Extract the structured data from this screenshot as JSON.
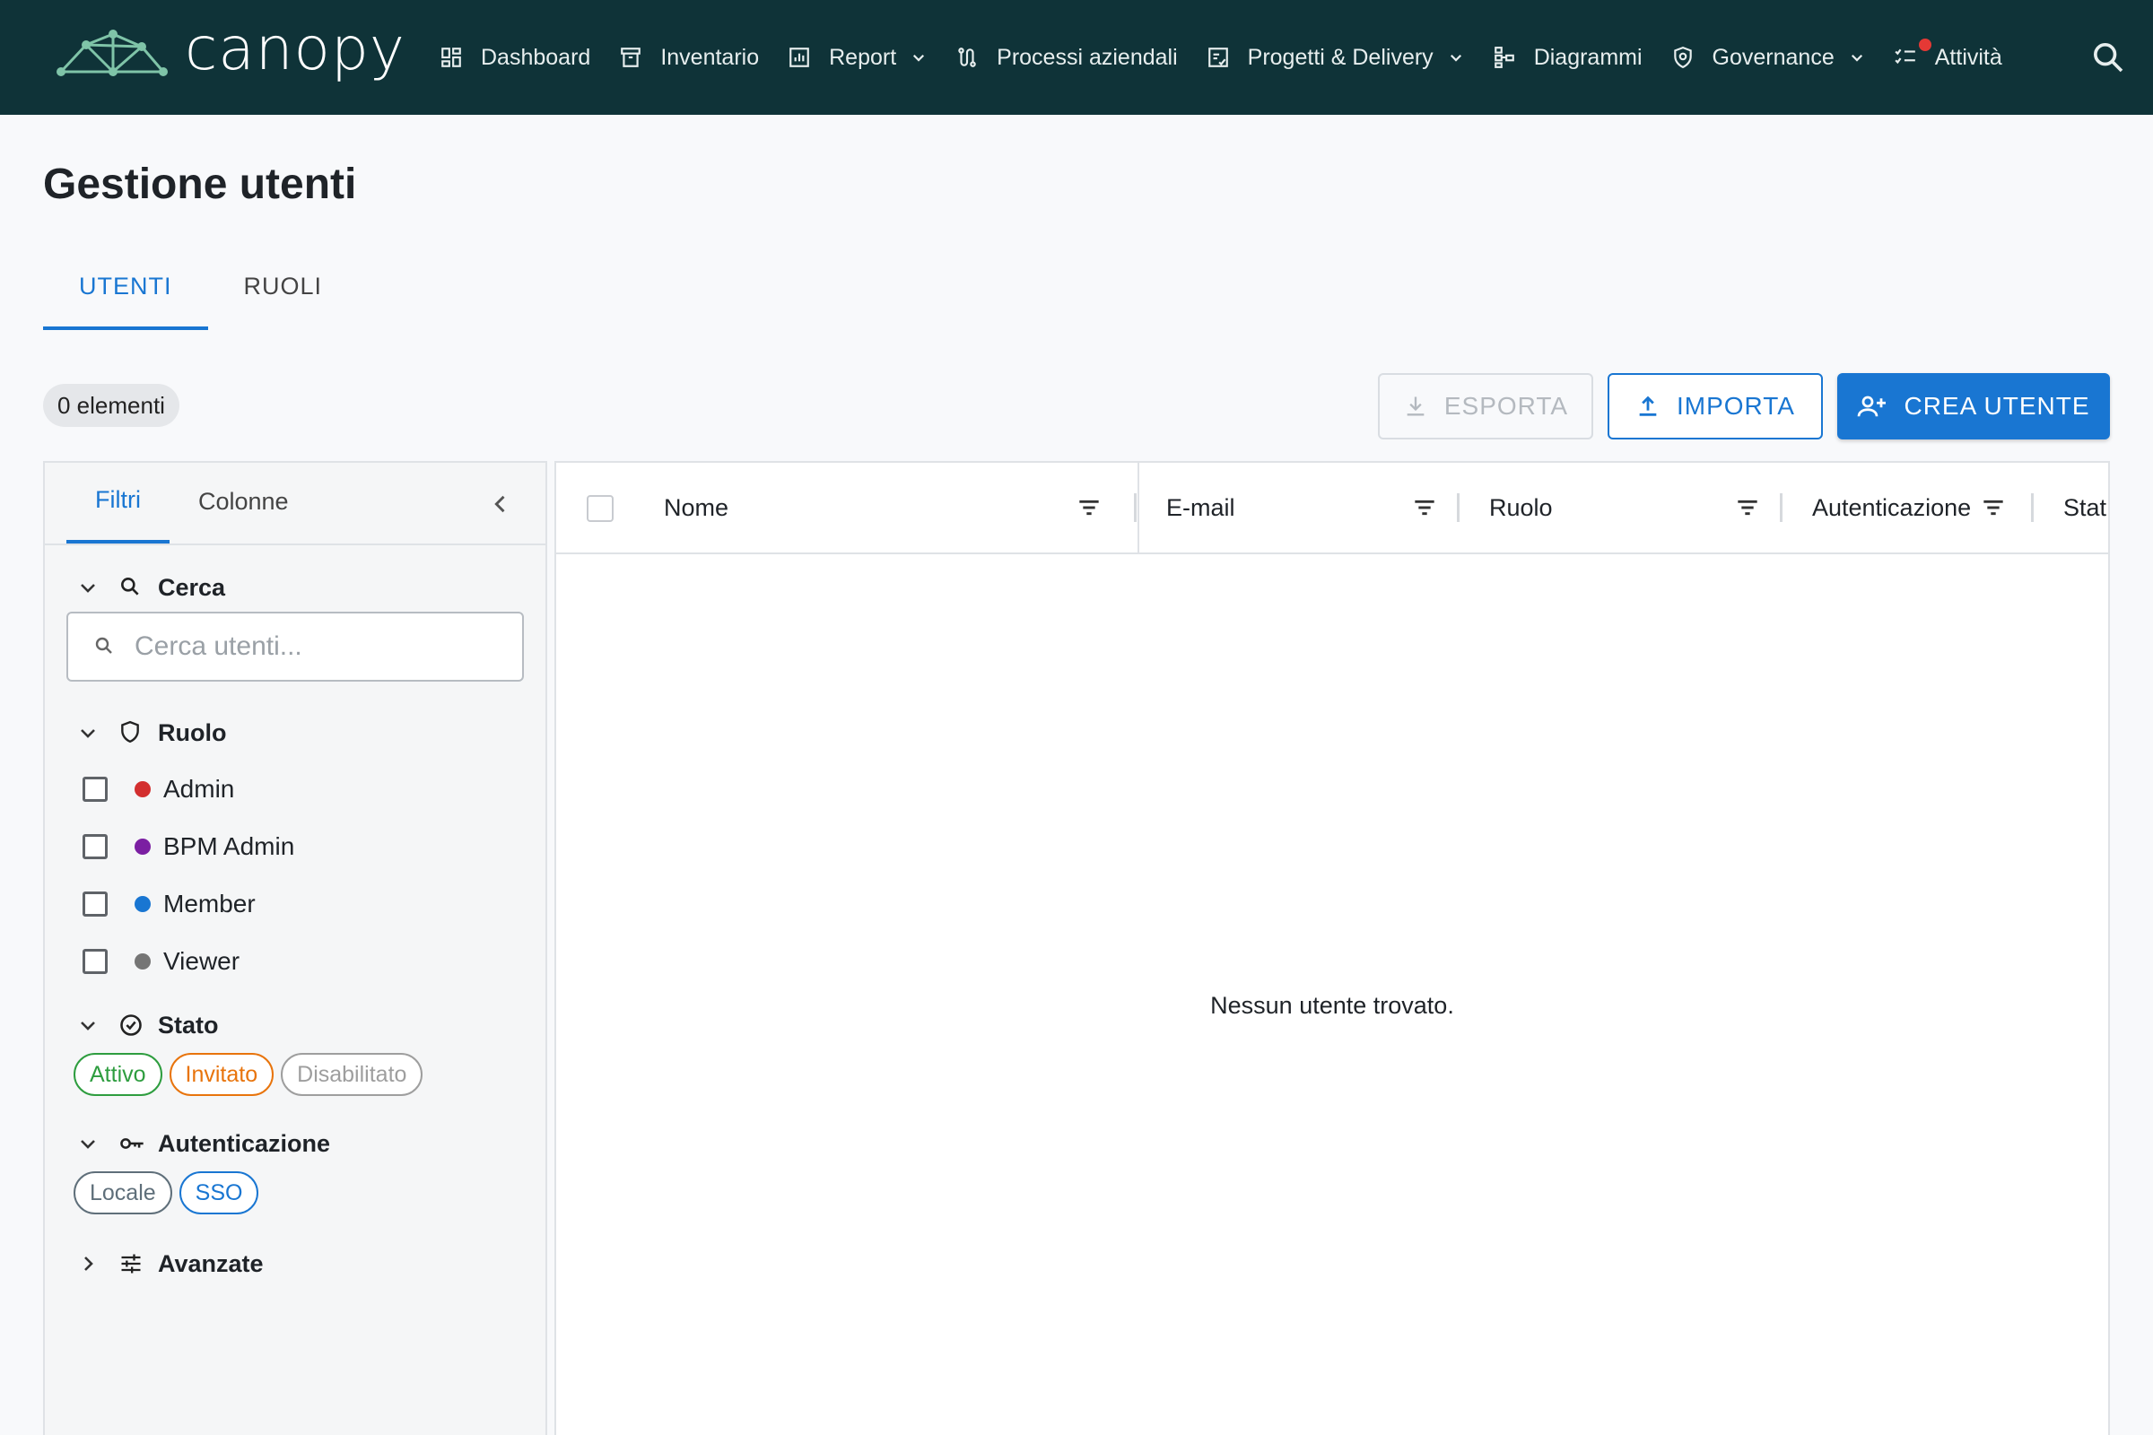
{
  "app": {
    "name": "canopy"
  },
  "nav": {
    "items": [
      {
        "label": "Dashboard",
        "icon": "dashboard-icon",
        "has_menu": false
      },
      {
        "label": "Inventario",
        "icon": "archive-icon",
        "has_menu": false
      },
      {
        "label": "Report",
        "icon": "bar-chart-icon",
        "has_menu": true
      },
      {
        "label": "Processi aziendali",
        "icon": "process-icon",
        "has_menu": false
      },
      {
        "label": "Progetti & Delivery",
        "icon": "project-icon",
        "has_menu": true
      },
      {
        "label": "Diagrammi",
        "icon": "diagram-icon",
        "has_menu": false
      },
      {
        "label": "Governance",
        "icon": "shield-icon",
        "has_menu": true
      },
      {
        "label": "Attività",
        "icon": "task-list-icon",
        "has_menu": false,
        "notification": true
      }
    ]
  },
  "page": {
    "title": "Gestione utenti"
  },
  "tabs": [
    {
      "label": "UTENTI",
      "active": true
    },
    {
      "label": "RUOLI",
      "active": false
    }
  ],
  "toolbar": {
    "count_label": "0 elementi",
    "export_label": "ESPORTA",
    "import_label": "IMPORTA",
    "create_label": "CREA UTENTE"
  },
  "filter_panel": {
    "tabs": [
      {
        "label": "Filtri",
        "active": true
      },
      {
        "label": "Colonne",
        "active": false
      }
    ],
    "search": {
      "title": "Cerca",
      "placeholder": "Cerca utenti..."
    },
    "role": {
      "title": "Ruolo",
      "options": [
        {
          "label": "Admin",
          "color": "#d32f2f"
        },
        {
          "label": "BPM Admin",
          "color": "#7b1fa2"
        },
        {
          "label": "Member",
          "color": "#1976d2"
        },
        {
          "label": "Viewer",
          "color": "#757575"
        }
      ]
    },
    "status": {
      "title": "Stato",
      "chips": [
        {
          "label": "Attivo",
          "color": "#2e9d3f"
        },
        {
          "label": "Invitato",
          "color": "#e8740c"
        },
        {
          "label": "Disabilitato",
          "color": "#9e9e9e"
        }
      ]
    },
    "auth": {
      "title": "Autenticazione",
      "chips": [
        {
          "label": "Locale",
          "color": "#5f6f7a"
        },
        {
          "label": "SSO",
          "color": "#1976d2"
        }
      ]
    },
    "advanced": {
      "title": "Avanzate"
    }
  },
  "grid": {
    "columns": [
      "Nome",
      "E-mail",
      "Ruolo",
      "Autenticazione",
      "Stat"
    ],
    "empty_message": "Nessun utente trovato."
  }
}
